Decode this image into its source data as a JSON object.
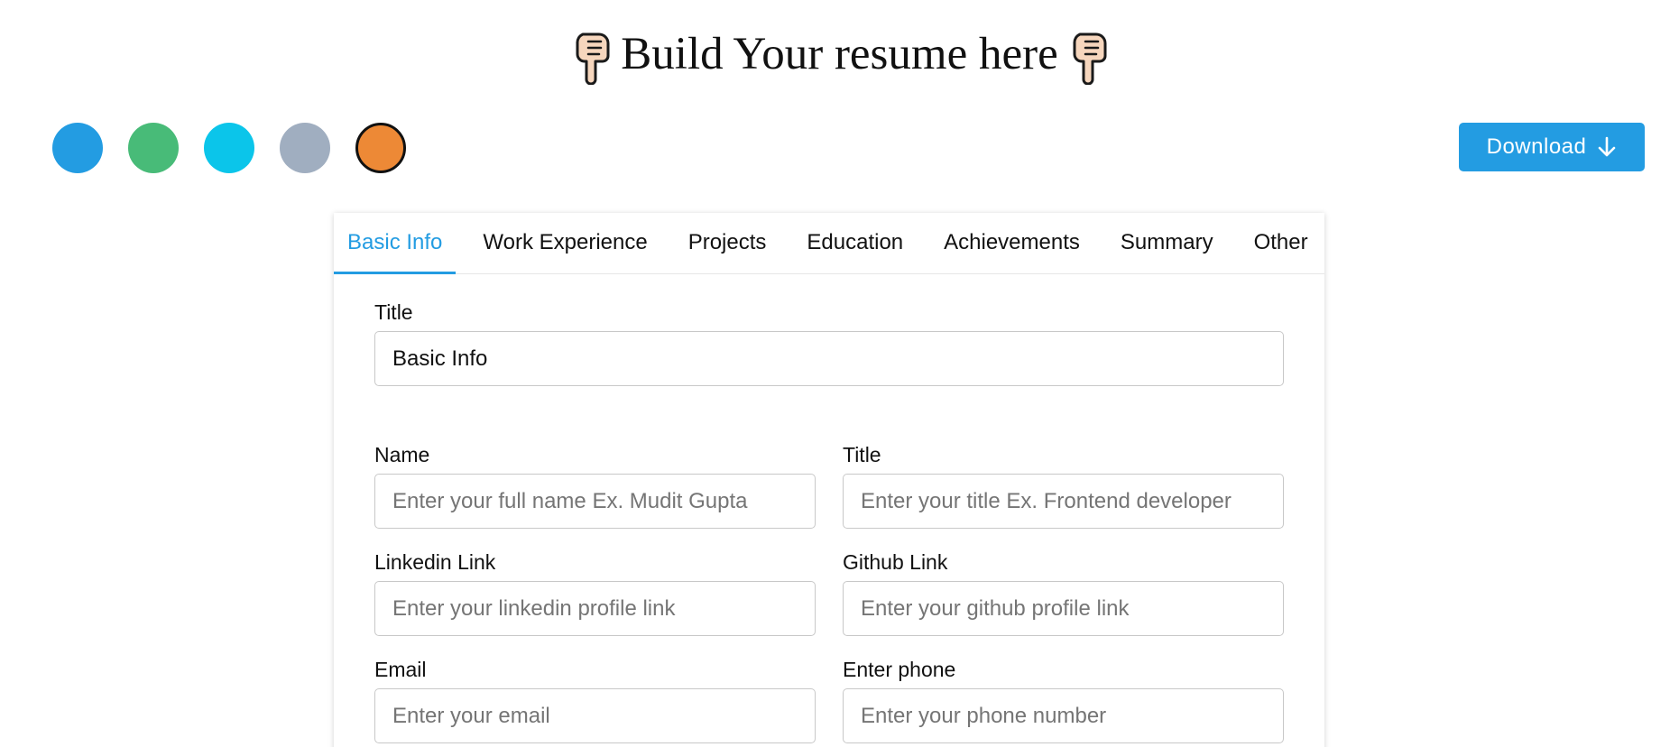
{
  "header": {
    "title": "Build Your resume here",
    "left_emoji": "backhand-index-pointing-down",
    "right_emoji": "backhand-index-pointing-down"
  },
  "color_swatches": [
    {
      "color": "#239ce2",
      "selected": false
    },
    {
      "color": "#48bb78",
      "selected": false
    },
    {
      "color": "#0bc5ea",
      "selected": false
    },
    {
      "color": "#a0aec0",
      "selected": false
    },
    {
      "color": "#ed8936",
      "selected": true
    }
  ],
  "download": {
    "label": "Download",
    "icon": "arrow-down-icon",
    "color": "#239ce2"
  },
  "tabs": [
    {
      "label": "Basic Info",
      "active": true
    },
    {
      "label": "Work Experience",
      "active": false
    },
    {
      "label": "Projects",
      "active": false
    },
    {
      "label": "Education",
      "active": false
    },
    {
      "label": "Achievements",
      "active": false
    },
    {
      "label": "Summary",
      "active": false
    },
    {
      "label": "Other",
      "active": false
    }
  ],
  "form": {
    "section_title": {
      "label": "Title",
      "value": "Basic Info"
    },
    "name": {
      "label": "Name",
      "placeholder": "Enter your full name Ex. Mudit Gupta",
      "value": ""
    },
    "title": {
      "label": "Title",
      "placeholder": "Enter your title Ex. Frontend developer",
      "value": ""
    },
    "linkedin": {
      "label": "Linkedin Link",
      "placeholder": "Enter your linkedin profile link",
      "value": ""
    },
    "github": {
      "label": "Github Link",
      "placeholder": "Enter your github profile link",
      "value": ""
    },
    "email": {
      "label": "Email",
      "placeholder": "Enter your email",
      "value": ""
    },
    "phone": {
      "label": "Enter phone",
      "placeholder": "Enter your phone number",
      "value": ""
    }
  },
  "accent_color": "#239ce2"
}
